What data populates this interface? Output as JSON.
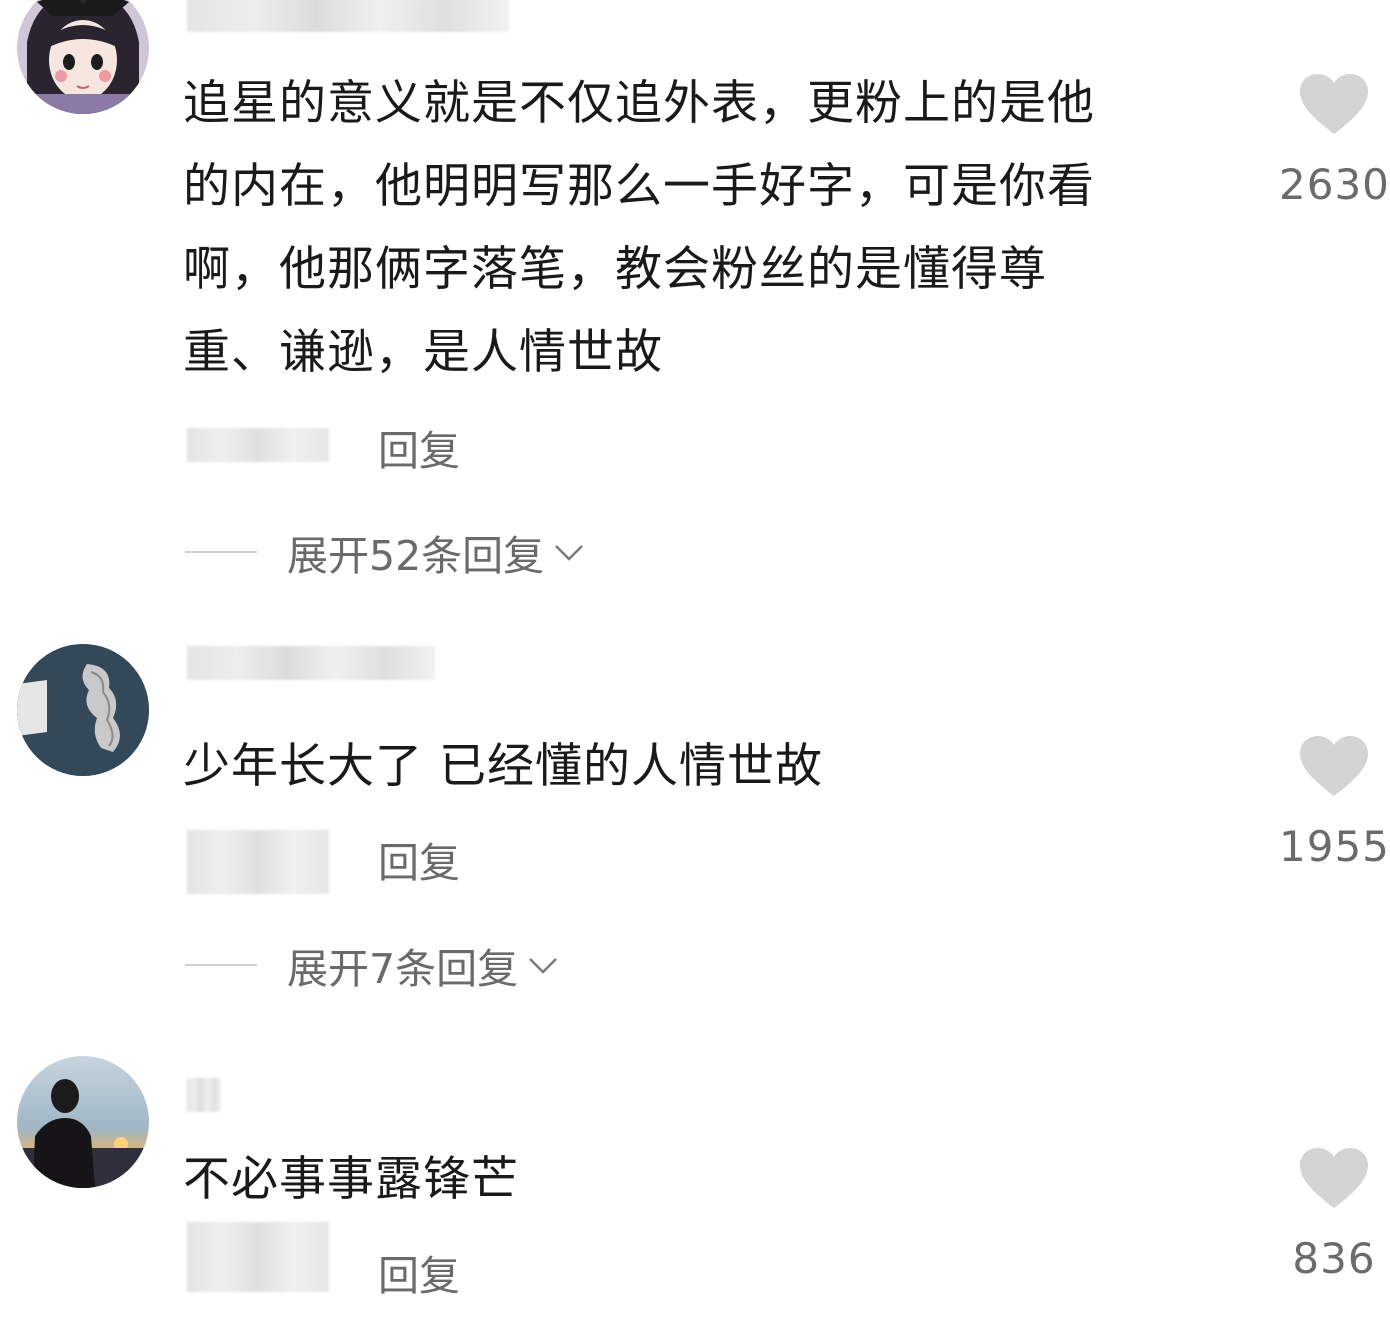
{
  "comments": [
    {
      "text": "追星的意义就是不仅追外表，更粉上的是他\n的内在，他明明写那么一手好字，可是你看\n啊，他那俩字落笔，教会粉丝的是懂得尊\n重、谦逊，是人情世故",
      "reply_label": "回复",
      "expand_label": "展开52条回复",
      "likes": "2630",
      "avatar_icon": "anime-girl-avatar"
    },
    {
      "text": "少年长大了 已经懂的人情世故",
      "reply_label": "回复",
      "expand_label": "展开7条回复",
      "likes": "1955",
      "avatar_icon": "map-avatar"
    },
    {
      "text": "不必事事露锋芒",
      "reply_label": "回复",
      "likes": "836",
      "avatar_icon": "sunset-silhouette-avatar"
    }
  ],
  "colors": {
    "heart": "#d4d4d4",
    "secondary_text": "#6a6a6a",
    "primary_text": "#1a1a1a"
  }
}
